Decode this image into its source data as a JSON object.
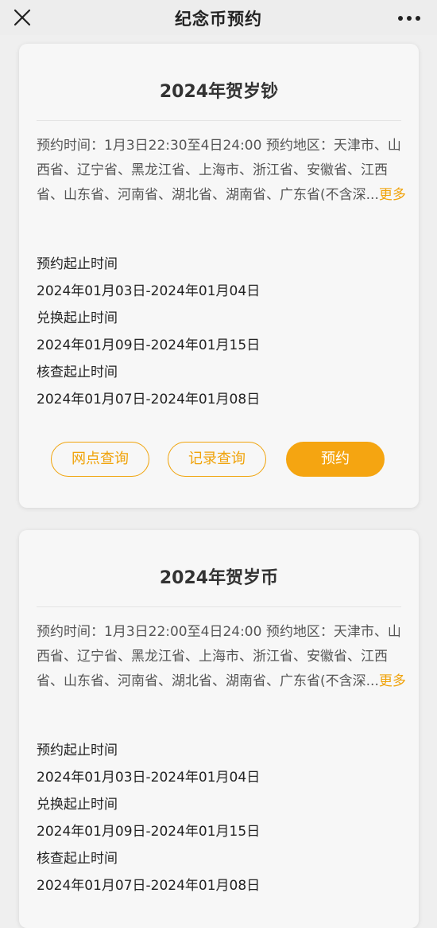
{
  "header": {
    "title": "纪念币预约"
  },
  "cards": [
    {
      "title": "2024年贺岁钞",
      "description": "预约时间：1月3日22:30至4日24:00 预约地区：天津市、山西省、辽宁省、黑龙江省、上海市、浙江省、安徽省、江西省、山东省、河南省、湖北省、湖南省、广东省(不含深...",
      "more_label": "更多",
      "schedule": [
        {
          "label": "预约起止时间",
          "value": "2024年01月03日-2024年01月04日"
        },
        {
          "label": "兑换起止时间",
          "value": "2024年01月09日-2024年01月15日"
        },
        {
          "label": "核查起止时间",
          "value": "2024年01月07日-2024年01月08日"
        }
      ],
      "buttons": {
        "branch_query": "网点查询",
        "record_query": "记录查询",
        "reserve": "预约"
      }
    },
    {
      "title": "2024年贺岁币",
      "description": "预约时间：1月3日22:00至4日24:00 预约地区：天津市、山西省、辽宁省、黑龙江省、上海市、浙江省、安徽省、江西省、山东省、河南省、湖北省、湖南省、广东省(不含深...",
      "more_label": "更多",
      "schedule": [
        {
          "label": "预约起止时间",
          "value": "2024年01月03日-2024年01月04日"
        },
        {
          "label": "兑换起止时间",
          "value": "2024年01月09日-2024年01月15日"
        },
        {
          "label": "核查起止时间",
          "value": "2024年01月07日-2024年01月08日"
        }
      ]
    }
  ],
  "icons": {
    "close": "close-icon",
    "more": "more-dots-icon"
  },
  "colors": {
    "accent": "#f5a511",
    "page_background": "#efefef",
    "card_background": "#f7f7f7"
  }
}
